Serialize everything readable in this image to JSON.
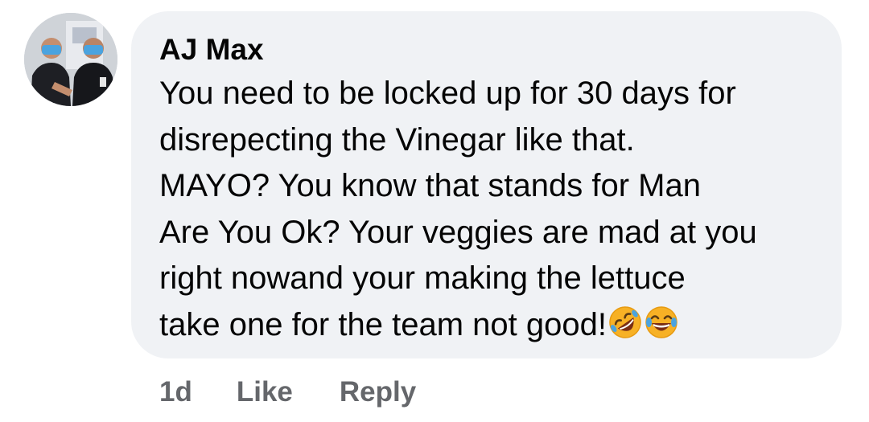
{
  "comment": {
    "author": "AJ Max",
    "lines": [
      "You need to be locked up for 30 days for",
      "disrepecting the Vinegar like that.",
      "MAYO? You know that stands for Man",
      "Are You Ok? Your veggies are mad at you",
      "right nowand your making the lettuce",
      "take one for the team not good!"
    ],
    "emojis": [
      "rolling-on-floor-laughing-emoji",
      "face-with-tears-of-joy-emoji"
    ]
  },
  "actions": {
    "timestamp": "1d",
    "like_label": "Like",
    "reply_label": "Reply"
  },
  "colors": {
    "bubble_bg": "#f0f2f5",
    "text": "#050505",
    "secondary_text": "#65676b",
    "emoji_yellow": "#f7b125",
    "emoji_mouth": "#7a2e14"
  }
}
